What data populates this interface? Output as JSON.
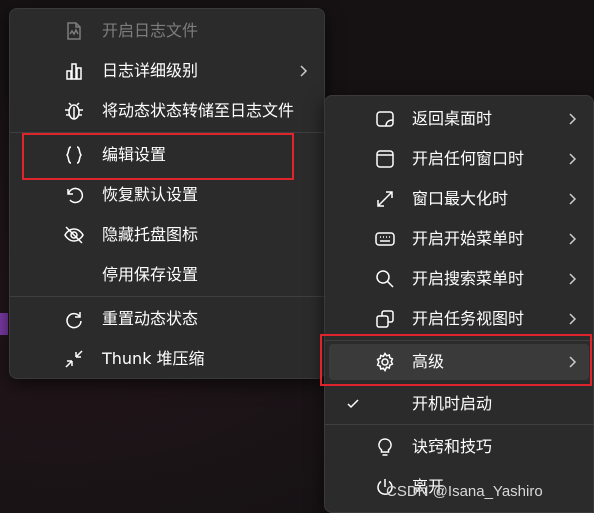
{
  "left_menu": {
    "items": [
      {
        "label": "开启日志文件",
        "icon": "log-file-icon",
        "disabled": true
      },
      {
        "label": "日志详细级别",
        "icon": "bar-chart-icon",
        "submenu": true
      },
      {
        "label": "将动态状态转储至日志文件",
        "icon": "bug-icon"
      },
      {
        "label": "编辑设置",
        "icon": "braces-icon"
      },
      {
        "label": "恢复默认设置",
        "icon": "undo-icon"
      },
      {
        "label": "隐藏托盘图标",
        "icon": "eye-off-icon"
      },
      {
        "label": "停用保存设置",
        "icon": ""
      },
      {
        "label": "重置动态状态",
        "icon": "refresh-icon"
      },
      {
        "label": "Thunk 堆压缩",
        "icon": "compress-icon"
      }
    ]
  },
  "right_menu": {
    "items": [
      {
        "label": "返回桌面时",
        "icon": "desktop-icon",
        "submenu": true
      },
      {
        "label": "开启任何窗口时",
        "icon": "window-icon",
        "submenu": true
      },
      {
        "label": "窗口最大化时",
        "icon": "maximize-icon",
        "submenu": true
      },
      {
        "label": "开启开始菜单时",
        "icon": "keyboard-icon",
        "submenu": true
      },
      {
        "label": "开启搜索菜单时",
        "icon": "search-icon",
        "submenu": true
      },
      {
        "label": "开启任务视图时",
        "icon": "task-view-icon",
        "submenu": true
      },
      {
        "label": "高级",
        "icon": "gear-icon",
        "submenu": true,
        "highlighted": true
      },
      {
        "label": "开机时启动",
        "icon": "checkmark-icon",
        "checked": true
      },
      {
        "label": "诀窍和技巧",
        "icon": "lightbulb-icon"
      },
      {
        "label": "离开",
        "icon": "power-icon"
      }
    ]
  },
  "watermark": "CSDN @Isana_Yashiro",
  "colors": {
    "menu_bg": "#2b2b2b",
    "highlight_box": "#e0242b",
    "text": "#ffffff",
    "disabled_text": "#7d7d7d"
  }
}
